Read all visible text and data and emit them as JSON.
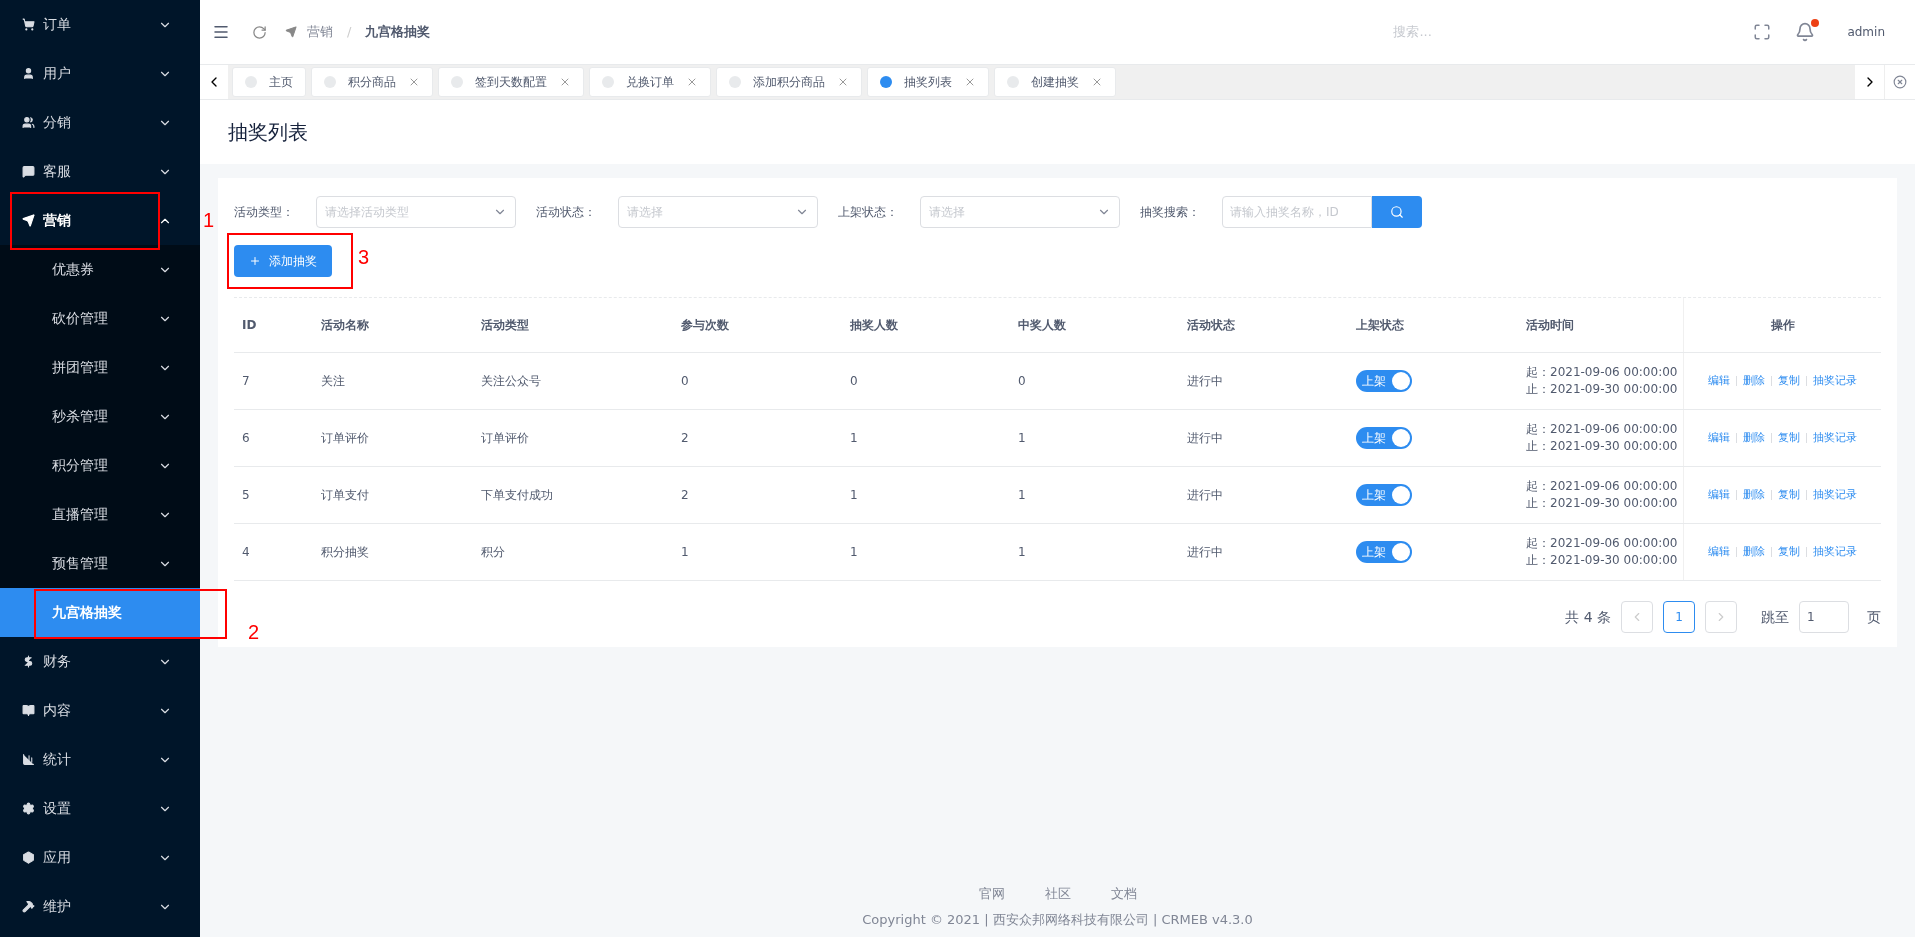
{
  "sidebar": {
    "items": [
      {
        "label": "订单",
        "expanded": false,
        "selected": false
      },
      {
        "label": "用户",
        "expanded": false,
        "selected": false
      },
      {
        "label": "分销",
        "expanded": false,
        "selected": false
      },
      {
        "label": "客服",
        "expanded": false,
        "selected": false
      },
      {
        "label": "营销",
        "expanded": true,
        "selected": false,
        "children": [
          {
            "label": "优惠券",
            "expanded": false,
            "selected": false
          },
          {
            "label": "砍价管理",
            "expanded": false,
            "selected": false
          },
          {
            "label": "拼团管理",
            "expanded": false,
            "selected": false
          },
          {
            "label": "秒杀管理",
            "expanded": false,
            "selected": false
          },
          {
            "label": "积分管理",
            "expanded": false,
            "selected": false
          },
          {
            "label": "直播管理",
            "expanded": false,
            "selected": false
          },
          {
            "label": "预售管理",
            "expanded": false,
            "selected": false
          },
          {
            "label": "九宫格抽奖",
            "selected": true
          }
        ]
      },
      {
        "label": "财务",
        "expanded": false,
        "selected": false
      },
      {
        "label": "内容",
        "expanded": false,
        "selected": false
      },
      {
        "label": "统计",
        "expanded": false,
        "selected": false
      },
      {
        "label": "设置",
        "expanded": false,
        "selected": false
      },
      {
        "label": "应用",
        "expanded": false,
        "selected": false
      },
      {
        "label": "维护",
        "expanded": false,
        "selected": false
      }
    ]
  },
  "header": {
    "breadcrumb": [
      "营销",
      "九宫格抽奖"
    ],
    "breadcrumb_separator": "/",
    "search": {
      "placeholder": "搜索..."
    },
    "notification_dot": true,
    "user": "admin"
  },
  "tabs": [
    {
      "label": "主页",
      "selected": false,
      "closable": false
    },
    {
      "label": "积分商品",
      "selected": false,
      "closable": true
    },
    {
      "label": "签到天数配置",
      "selected": false,
      "closable": true
    },
    {
      "label": "兑换订单",
      "selected": false,
      "closable": true
    },
    {
      "label": "添加积分商品",
      "selected": false,
      "closable": true
    },
    {
      "label": "抽奖列表",
      "selected": true,
      "closable": true
    },
    {
      "label": "创建抽奖",
      "selected": false,
      "closable": true
    }
  ],
  "page_title": "抽奖列表",
  "filters": [
    {
      "label": "活动类型：",
      "placeholder": "请选择活动类型",
      "kind": "select"
    },
    {
      "label": "活动状态：",
      "placeholder": "请选择",
      "kind": "select"
    },
    {
      "label": "上架状态：",
      "placeholder": "请选择",
      "kind": "select"
    },
    {
      "label": "抽奖搜索：",
      "placeholder": "请输入抽奖名称，ID",
      "kind": "search"
    }
  ],
  "add_button": "添加抽奖",
  "table": {
    "columns": [
      "ID",
      "活动名称",
      "活动类型",
      "参与次数",
      "抽奖人数",
      "中奖人数",
      "活动状态",
      "上架状态",
      "活动时间",
      "操作"
    ],
    "rows": [
      {
        "id": "7",
        "name": "关注",
        "type": "关注公众号",
        "joins": "0",
        "drawers": "0",
        "winners": "0",
        "status": "进行中",
        "listed": {
          "label": "上架",
          "on": true
        },
        "time": [
          "起：2021-09-06 00:00:00",
          "止：2021-09-30 00:00:00"
        ],
        "actions": [
          "编辑",
          "删除",
          "复制",
          "抽奖记录"
        ]
      },
      {
        "id": "6",
        "name": "订单评价",
        "type": "订单评价",
        "joins": "2",
        "drawers": "1",
        "winners": "1",
        "status": "进行中",
        "listed": {
          "label": "上架",
          "on": true
        },
        "time": [
          "起：2021-09-06 00:00:00",
          "止：2021-09-30 00:00:00"
        ],
        "actions": [
          "编辑",
          "删除",
          "复制",
          "抽奖记录"
        ]
      },
      {
        "id": "5",
        "name": "订单支付",
        "type": "下单支付成功",
        "joins": "2",
        "drawers": "1",
        "winners": "1",
        "status": "进行中",
        "listed": {
          "label": "上架",
          "on": true
        },
        "time": [
          "起：2021-09-06 00:00:00",
          "止：2021-09-30 00:00:00"
        ],
        "actions": [
          "编辑",
          "删除",
          "复制",
          "抽奖记录"
        ]
      },
      {
        "id": "4",
        "name": "积分抽奖",
        "type": "积分",
        "joins": "1",
        "drawers": "1",
        "winners": "1",
        "status": "进行中",
        "listed": {
          "label": "上架",
          "on": true
        },
        "time": [
          "起：2021-09-06 00:00:00",
          "止：2021-09-30 00:00:00"
        ],
        "actions": [
          "编辑",
          "删除",
          "复制",
          "抽奖记录"
        ]
      }
    ]
  },
  "pagination": {
    "total": "共 4 条",
    "pages": [
      {
        "label": "1",
        "selected": true
      }
    ],
    "jump_label": "跳至",
    "jump_value": "1",
    "page_unit": "页"
  },
  "footer": {
    "links": [
      "官网",
      "社区",
      "文档"
    ],
    "copyright": "Copyright © 2021 | 西安众邦网络科技有限公司 | CRMEB v4.3.0"
  },
  "annotations": [
    "1",
    "2",
    "3"
  ]
}
